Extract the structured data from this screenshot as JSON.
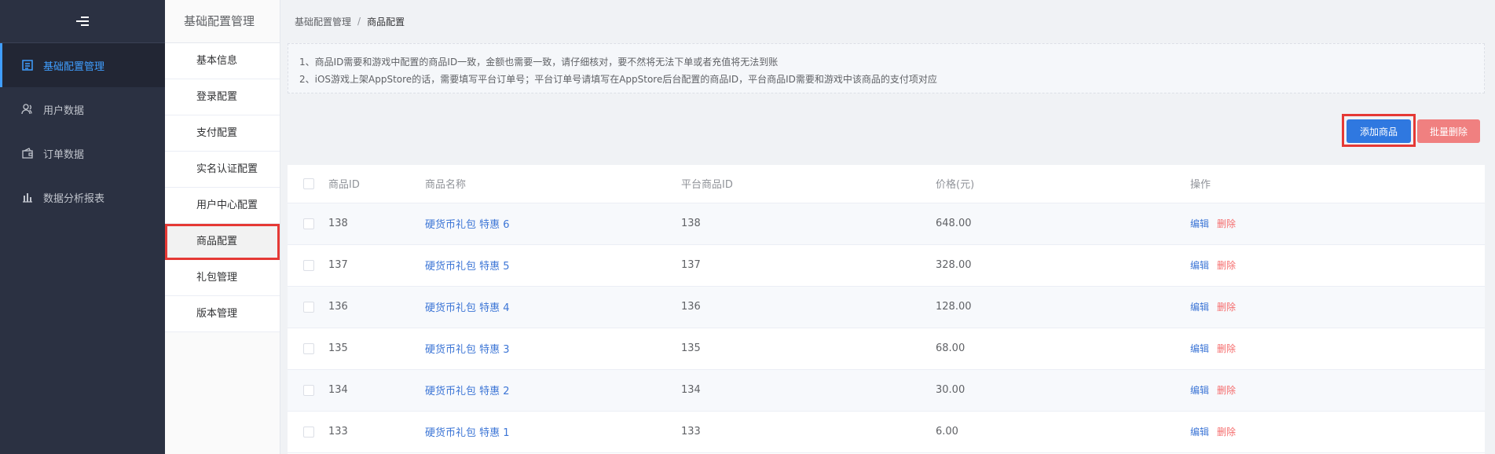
{
  "sidebar": {
    "items": [
      {
        "label": "基础配置管理",
        "icon": "config-icon",
        "active": true
      },
      {
        "label": "用户数据",
        "icon": "users-icon",
        "active": false
      },
      {
        "label": "订单数据",
        "icon": "wallet-icon",
        "active": false
      },
      {
        "label": "数据分析报表",
        "icon": "bar-chart-icon",
        "active": false
      }
    ]
  },
  "subnav": {
    "title": "基础配置管理",
    "items": [
      {
        "label": "基本信息"
      },
      {
        "label": "登录配置"
      },
      {
        "label": "支付配置"
      },
      {
        "label": "实名认证配置"
      },
      {
        "label": "用户中心配置"
      },
      {
        "label": "商品配置"
      },
      {
        "label": "礼包管理"
      },
      {
        "label": "版本管理"
      }
    ]
  },
  "breadcrumb": {
    "parent": "基础配置管理",
    "separator": "/",
    "current": "商品配置"
  },
  "notice": {
    "line1": "1、商品ID需要和游戏中配置的商品ID一致，金额也需要一致，请仔细核对，要不然将无法下单或者充值将无法到账",
    "line2": "2、iOS游戏上架AppStore的话，需要填写平台订单号；平台订单号请填写在AppStore后台配置的商品ID，平台商品ID需要和游戏中该商品的支付项对应"
  },
  "toolbar": {
    "add_label": "添加商品",
    "batch_delete_label": "批量删除"
  },
  "table": {
    "headers": {
      "id": "商品ID",
      "name": "商品名称",
      "platform_id": "平台商品ID",
      "price": "价格(元)",
      "ops": "操作"
    },
    "rows": [
      {
        "id": "138",
        "name": "硬货币礼包 特惠 6",
        "platform_id": "138",
        "price": "648.00"
      },
      {
        "id": "137",
        "name": "硬货币礼包 特惠 5",
        "platform_id": "137",
        "price": "328.00"
      },
      {
        "id": "136",
        "name": "硬货币礼包 特惠 4",
        "platform_id": "136",
        "price": "128.00"
      },
      {
        "id": "135",
        "name": "硬货币礼包 特惠 3",
        "platform_id": "135",
        "price": "68.00"
      },
      {
        "id": "134",
        "name": "硬货币礼包 特惠 2",
        "platform_id": "134",
        "price": "30.00"
      },
      {
        "id": "133",
        "name": "硬货币礼包 特惠 1",
        "platform_id": "133",
        "price": "6.00"
      }
    ],
    "edit_label": "编辑",
    "delete_label": "删除"
  },
  "colors": {
    "sidebar_bg": "#2b3142",
    "accent": "#409eff",
    "primary_button": "#2f78e0",
    "danger_button": "#f08080",
    "highlight_border": "#e53935"
  }
}
